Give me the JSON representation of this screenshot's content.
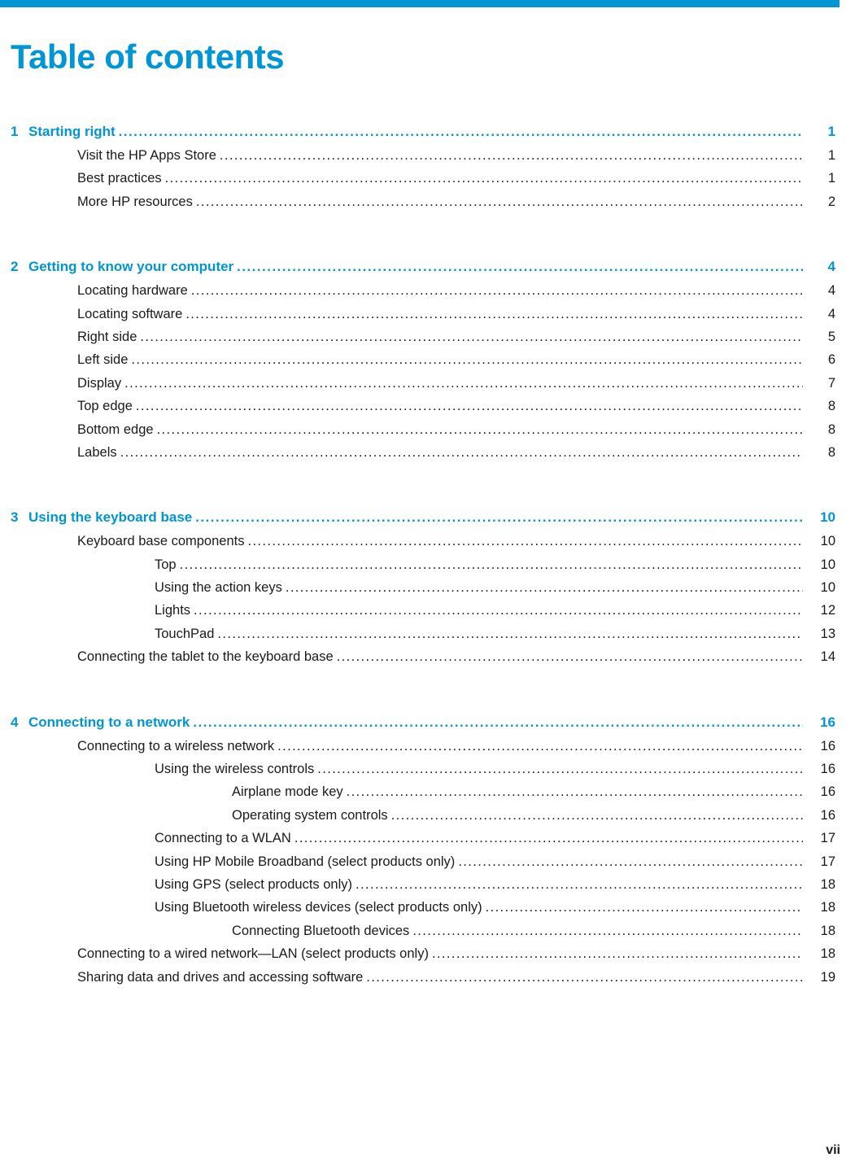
{
  "theme": {
    "accent": "#0096d6",
    "text": "#1a1a1a",
    "background": "#ffffff"
  },
  "header": {
    "title": "Table of contents"
  },
  "footer": {
    "page_label": "vii"
  },
  "toc": {
    "chapters": [
      {
        "number": "1",
        "title": "Starting right",
        "page": "1",
        "entries": [
          {
            "level": 1,
            "label": "Visit the HP Apps Store",
            "page": "1"
          },
          {
            "level": 1,
            "label": "Best practices",
            "page": "1"
          },
          {
            "level": 1,
            "label": "More HP resources",
            "page": "2"
          }
        ]
      },
      {
        "number": "2",
        "title": "Getting to know your computer",
        "page": "4",
        "entries": [
          {
            "level": 1,
            "label": "Locating hardware",
            "page": "4"
          },
          {
            "level": 1,
            "label": "Locating software",
            "page": "4"
          },
          {
            "level": 1,
            "label": "Right side",
            "page": "5"
          },
          {
            "level": 1,
            "label": "Left side",
            "page": "6"
          },
          {
            "level": 1,
            "label": "Display",
            "page": "7"
          },
          {
            "level": 1,
            "label": "Top edge",
            "page": "8"
          },
          {
            "level": 1,
            "label": "Bottom edge",
            "page": "8"
          },
          {
            "level": 1,
            "label": "Labels",
            "page": "8"
          }
        ]
      },
      {
        "number": "3",
        "title": "Using the keyboard base",
        "page": "10",
        "entries": [
          {
            "level": 1,
            "label": "Keyboard base components",
            "page": "10"
          },
          {
            "level": 2,
            "label": "Top",
            "page": "10"
          },
          {
            "level": 2,
            "label": "Using the action keys",
            "page": "10"
          },
          {
            "level": 2,
            "label": "Lights",
            "page": "12"
          },
          {
            "level": 2,
            "label": "TouchPad",
            "page": "13"
          },
          {
            "level": 1,
            "label": "Connecting the tablet to the keyboard base",
            "page": "14"
          }
        ]
      },
      {
        "number": "4",
        "title": "Connecting to a network",
        "page": "16",
        "entries": [
          {
            "level": 1,
            "label": "Connecting to a wireless network",
            "page": "16"
          },
          {
            "level": 2,
            "label": "Using the wireless controls",
            "page": "16"
          },
          {
            "level": 3,
            "label": "Airplane mode key",
            "page": "16"
          },
          {
            "level": 3,
            "label": "Operating system controls",
            "page": "16"
          },
          {
            "level": 2,
            "label": "Connecting to a WLAN",
            "page": "17"
          },
          {
            "level": 2,
            "label": "Using HP Mobile Broadband (select products only)",
            "page": "17"
          },
          {
            "level": 2,
            "label": "Using GPS (select products only)",
            "page": "18"
          },
          {
            "level": 2,
            "label": "Using Bluetooth wireless devices (select products only)",
            "page": "18"
          },
          {
            "level": 3,
            "label": "Connecting Bluetooth devices",
            "page": "18"
          },
          {
            "level": 1,
            "label": "Connecting to a wired network—LAN (select products only)",
            "page": "18"
          },
          {
            "level": 1,
            "label": "Sharing data and drives and accessing software",
            "page": "19"
          }
        ]
      }
    ]
  }
}
